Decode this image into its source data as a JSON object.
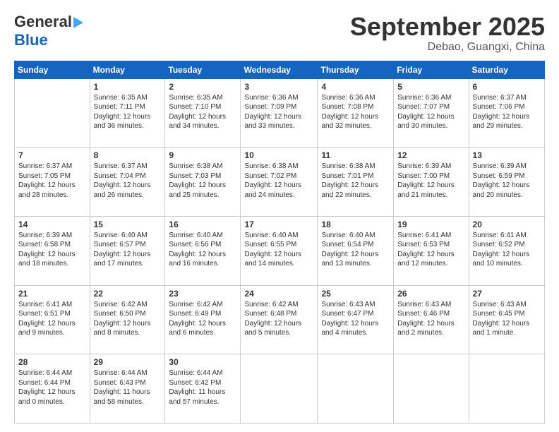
{
  "header": {
    "logo_line1": "General",
    "logo_line2": "Blue",
    "month": "September 2025",
    "location": "Debao, Guangxi, China"
  },
  "weekdays": [
    "Sunday",
    "Monday",
    "Tuesday",
    "Wednesday",
    "Thursday",
    "Friday",
    "Saturday"
  ],
  "weeks": [
    [
      {
        "date": "",
        "info": ""
      },
      {
        "date": "1",
        "info": "Sunrise: 6:35 AM\nSunset: 7:11 PM\nDaylight: 12 hours\nand 36 minutes."
      },
      {
        "date": "2",
        "info": "Sunrise: 6:35 AM\nSunset: 7:10 PM\nDaylight: 12 hours\nand 34 minutes."
      },
      {
        "date": "3",
        "info": "Sunrise: 6:36 AM\nSunset: 7:09 PM\nDaylight: 12 hours\nand 33 minutes."
      },
      {
        "date": "4",
        "info": "Sunrise: 6:36 AM\nSunset: 7:08 PM\nDaylight: 12 hours\nand 32 minutes."
      },
      {
        "date": "5",
        "info": "Sunrise: 6:36 AM\nSunset: 7:07 PM\nDaylight: 12 hours\nand 30 minutes."
      },
      {
        "date": "6",
        "info": "Sunrise: 6:37 AM\nSunset: 7:06 PM\nDaylight: 12 hours\nand 29 minutes."
      }
    ],
    [
      {
        "date": "7",
        "info": "Sunrise: 6:37 AM\nSunset: 7:05 PM\nDaylight: 12 hours\nand 28 minutes."
      },
      {
        "date": "8",
        "info": "Sunrise: 6:37 AM\nSunset: 7:04 PM\nDaylight: 12 hours\nand 26 minutes."
      },
      {
        "date": "9",
        "info": "Sunrise: 6:38 AM\nSunset: 7:03 PM\nDaylight: 12 hours\nand 25 minutes."
      },
      {
        "date": "10",
        "info": "Sunrise: 6:38 AM\nSunset: 7:02 PM\nDaylight: 12 hours\nand 24 minutes."
      },
      {
        "date": "11",
        "info": "Sunrise: 6:38 AM\nSunset: 7:01 PM\nDaylight: 12 hours\nand 22 minutes."
      },
      {
        "date": "12",
        "info": "Sunrise: 6:39 AM\nSunset: 7:00 PM\nDaylight: 12 hours\nand 21 minutes."
      },
      {
        "date": "13",
        "info": "Sunrise: 6:39 AM\nSunset: 6:59 PM\nDaylight: 12 hours\nand 20 minutes."
      }
    ],
    [
      {
        "date": "14",
        "info": "Sunrise: 6:39 AM\nSunset: 6:58 PM\nDaylight: 12 hours\nand 18 minutes."
      },
      {
        "date": "15",
        "info": "Sunrise: 6:40 AM\nSunset: 6:57 PM\nDaylight: 12 hours\nand 17 minutes."
      },
      {
        "date": "16",
        "info": "Sunrise: 6:40 AM\nSunset: 6:56 PM\nDaylight: 12 hours\nand 16 minutes."
      },
      {
        "date": "17",
        "info": "Sunrise: 6:40 AM\nSunset: 6:55 PM\nDaylight: 12 hours\nand 14 minutes."
      },
      {
        "date": "18",
        "info": "Sunrise: 6:40 AM\nSunset: 6:54 PM\nDaylight: 12 hours\nand 13 minutes."
      },
      {
        "date": "19",
        "info": "Sunrise: 6:41 AM\nSunset: 6:53 PM\nDaylight: 12 hours\nand 12 minutes."
      },
      {
        "date": "20",
        "info": "Sunrise: 6:41 AM\nSunset: 6:52 PM\nDaylight: 12 hours\nand 10 minutes."
      }
    ],
    [
      {
        "date": "21",
        "info": "Sunrise: 6:41 AM\nSunset: 6:51 PM\nDaylight: 12 hours\nand 9 minutes."
      },
      {
        "date": "22",
        "info": "Sunrise: 6:42 AM\nSunset: 6:50 PM\nDaylight: 12 hours\nand 8 minutes."
      },
      {
        "date": "23",
        "info": "Sunrise: 6:42 AM\nSunset: 6:49 PM\nDaylight: 12 hours\nand 6 minutes."
      },
      {
        "date": "24",
        "info": "Sunrise: 6:42 AM\nSunset: 6:48 PM\nDaylight: 12 hours\nand 5 minutes."
      },
      {
        "date": "25",
        "info": "Sunrise: 6:43 AM\nSunset: 6:47 PM\nDaylight: 12 hours\nand 4 minutes."
      },
      {
        "date": "26",
        "info": "Sunrise: 6:43 AM\nSunset: 6:46 PM\nDaylight: 12 hours\nand 2 minutes."
      },
      {
        "date": "27",
        "info": "Sunrise: 6:43 AM\nSunset: 6:45 PM\nDaylight: 12 hours\nand 1 minute."
      }
    ],
    [
      {
        "date": "28",
        "info": "Sunrise: 6:44 AM\nSunset: 6:44 PM\nDaylight: 12 hours\nand 0 minutes."
      },
      {
        "date": "29",
        "info": "Sunrise: 6:44 AM\nSunset: 6:43 PM\nDaylight: 11 hours\nand 58 minutes."
      },
      {
        "date": "30",
        "info": "Sunrise: 6:44 AM\nSunset: 6:42 PM\nDaylight: 11 hours\nand 57 minutes."
      },
      {
        "date": "",
        "info": ""
      },
      {
        "date": "",
        "info": ""
      },
      {
        "date": "",
        "info": ""
      },
      {
        "date": "",
        "info": ""
      }
    ]
  ]
}
